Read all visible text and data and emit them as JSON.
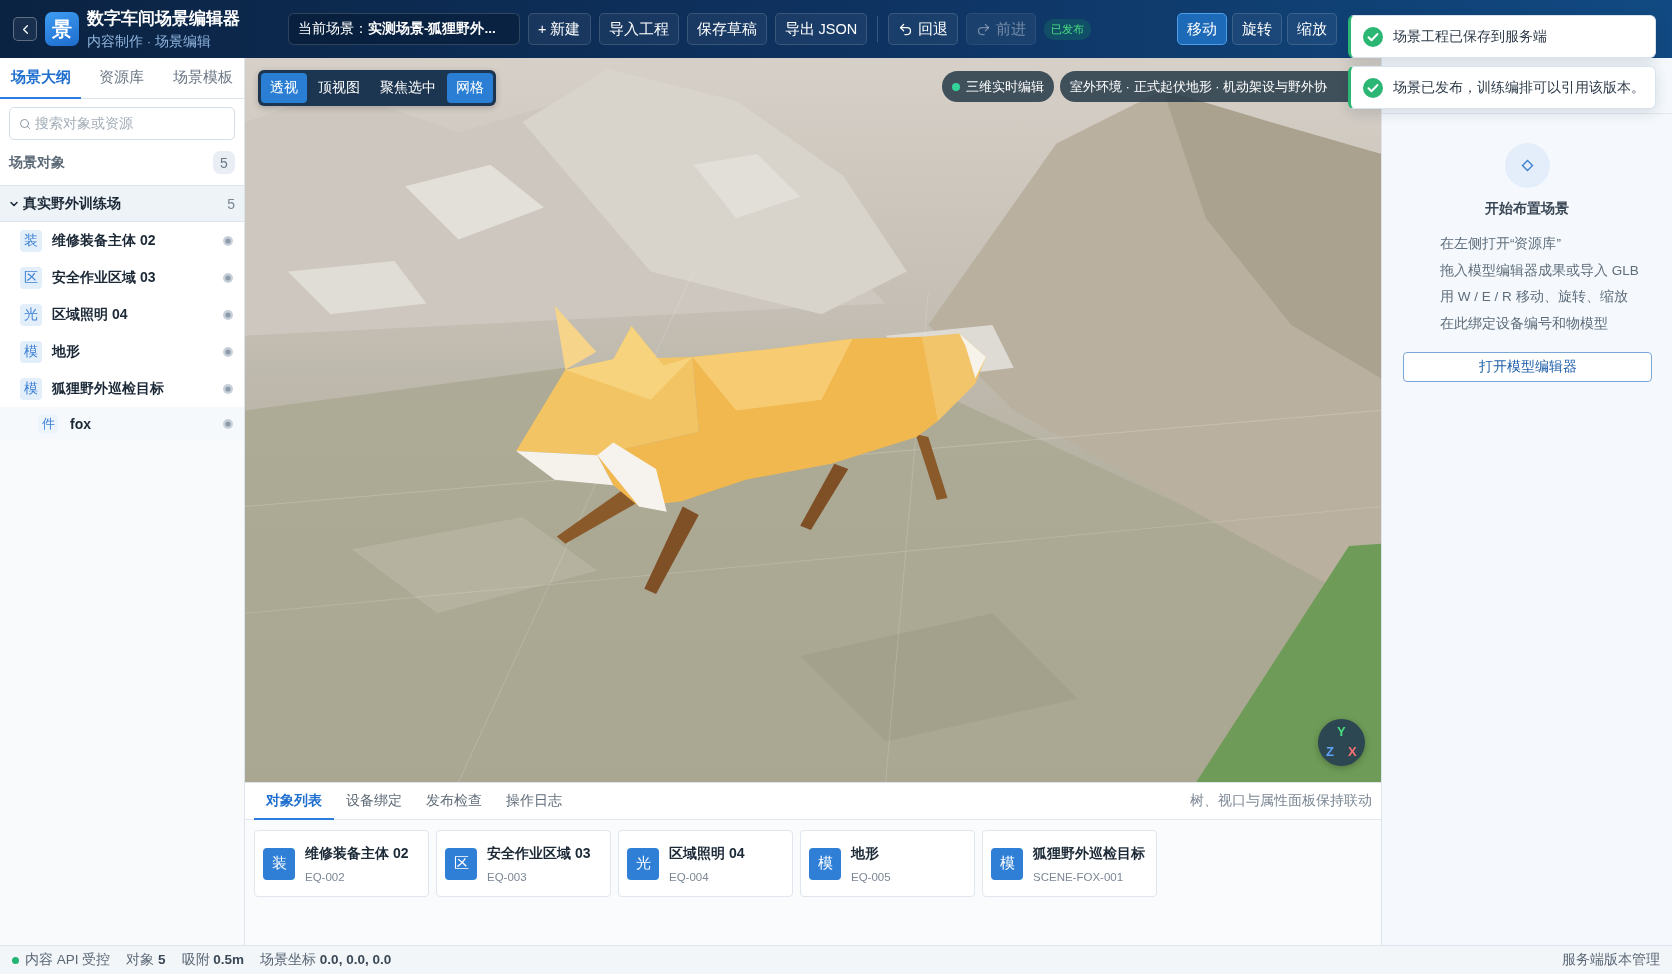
{
  "header": {
    "logo": "景",
    "title": "数字车间场景编辑器",
    "subtitle": "内容制作 · 场景编辑",
    "current_scene": "当前场景：**实测场景-狐狸野外...**",
    "actions": [
      "+ 新建",
      "导入工程",
      "保存草稿",
      "导出 JSON"
    ],
    "history": [
      {
        "kind": "undo",
        "label": "回退",
        "disabled": false
      },
      {
        "kind": "redo",
        "label": "前进",
        "disabled": true
      }
    ],
    "publish_badge": "已发布",
    "transform_modes": [
      {
        "label": "移动",
        "selected": true
      },
      {
        "label": "旋转",
        "selected": false
      },
      {
        "label": "缩放",
        "selected": false
      }
    ]
  },
  "toasts": [
    {
      "kind": "success",
      "message": "场景工程已保存到服务端"
    },
    {
      "kind": "success",
      "message": "场景已发布，训练编排可以引用该版本。"
    }
  ],
  "sidebar": {
    "tabs": [
      {
        "label": "场景大纲",
        "selected": true
      },
      {
        "label": "资源库",
        "selected": false
      },
      {
        "label": "场景模板",
        "selected": false
      }
    ],
    "search": {
      "placeholder": "搜索对象或资源"
    },
    "section": {
      "title": "场景对象",
      "count": "5"
    },
    "tree": {
      "label": "真实野外训练场",
      "count": "5",
      "expanded": true,
      "children": [
        {
          "badge": "装",
          "label": "维修装备主体 02",
          "visible": true
        },
        {
          "badge": "区",
          "label": "安全作业区域 03",
          "visible": true
        },
        {
          "badge": "光",
          "label": "区域照明 04",
          "visible": true
        },
        {
          "badge": "模",
          "label": "地形",
          "visible": true
        },
        {
          "badge": "模",
          "label": "狐狸野外巡检目标",
          "visible": true,
          "children": [
            {
              "badge": "件",
              "label": "fox",
              "visible": true
            }
          ]
        }
      ]
    }
  },
  "viewport": {
    "view_modes": [
      {
        "label": "透视",
        "selected": true
      },
      {
        "label": "顶视图",
        "selected": false
      },
      {
        "label": "聚焦选中",
        "selected": false
      },
      {
        "label": "网格",
        "selected": true
      }
    ],
    "live_badge": "三维实时编辑",
    "environment": "室外环境 · 正式起伏地形 · 机动架设与野外协",
    "gizmo": [
      {
        "label": "Y",
        "color": "#4ade80"
      },
      {
        "label": "Z",
        "color": "#60a5fa"
      },
      {
        "label": "X",
        "color": "#f87171"
      }
    ]
  },
  "bottom_panel": {
    "tabs": [
      {
        "label": "对象列表",
        "selected": true
      },
      {
        "label": "设备绑定",
        "selected": false
      },
      {
        "label": "发布检查",
        "selected": false
      },
      {
        "label": "操作日志",
        "selected": false
      }
    ],
    "note": "树、视口与属性面板保持联动",
    "cards": [
      {
        "badge": "装",
        "title": "维修装备主体 02",
        "code": "EQ-002"
      },
      {
        "badge": "区",
        "title": "安全作业区域 03",
        "code": "EQ-003"
      },
      {
        "badge": "光",
        "title": "区域照明 04",
        "code": "EQ-004"
      },
      {
        "badge": "模",
        "title": "地形",
        "code": "EQ-005"
      },
      {
        "badge": "模",
        "title": "狐狸野外巡检目标",
        "code": "SCENE-FOX-001"
      }
    ]
  },
  "inspector": {
    "title": "开始布置场景",
    "hints": [
      "在左侧打开“资源库”",
      "拖入模型编辑器成果或导入 GLB",
      "用 W / E / R 移动、旋转、缩放",
      "在此绑定设备编号和物模型"
    ],
    "button": "打开模型编辑器"
  },
  "status_bar": {
    "api": {
      "label": "内容 API 受控",
      "online": true
    },
    "stats": [
      "对象 **5**",
      "吸附 **0.5m**",
      "场景坐标 **0.0, 0.0, 0.0**"
    ],
    "right": "服务端版本管理"
  }
}
